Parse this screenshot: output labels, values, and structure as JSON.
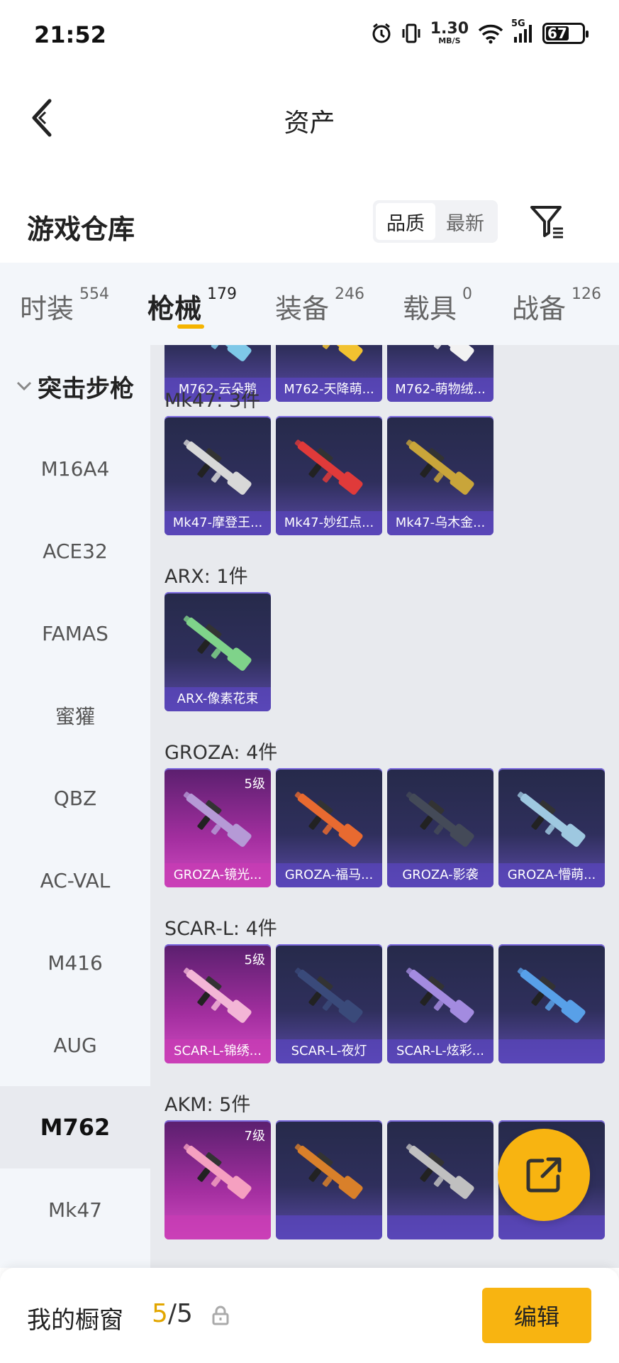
{
  "status": {
    "time": "21:52",
    "speed_value": "1.30",
    "speed_unit": "MB/S",
    "network": "5G",
    "battery": "67"
  },
  "header": {
    "title": "资产"
  },
  "warehouse": {
    "title": "游戏仓库",
    "sort_options": [
      "品质",
      "最新"
    ],
    "sort_selected": "品质"
  },
  "tabs": [
    {
      "label": "时装",
      "count": "554"
    },
    {
      "label": "枪械",
      "count": "179"
    },
    {
      "label": "装备",
      "count": "246"
    },
    {
      "label": "载具",
      "count": "0"
    },
    {
      "label": "战备",
      "count": "126"
    }
  ],
  "active_tab": "枪械",
  "sidebar": {
    "category": "突击步枪",
    "items": [
      "M16A4",
      "ACE32",
      "FAMAS",
      "蜜獾",
      "QBZ",
      "AC-VAL",
      "M416",
      "AUG",
      "M762",
      "Mk47"
    ],
    "selected": "M762"
  },
  "groups": [
    {
      "title": "",
      "items": [
        {
          "name": "M762-云朵鹅",
          "badge": ""
        },
        {
          "name": "M762-天降萌...",
          "badge": ""
        },
        {
          "name": "M762-萌物绒...",
          "badge": ""
        }
      ]
    },
    {
      "title": "Mk47: 3件",
      "items": [
        {
          "name": "Mk47-摩登王...",
          "badge": ""
        },
        {
          "name": "Mk47-妙红点...",
          "badge": ""
        },
        {
          "name": "Mk47-乌木金...",
          "badge": ""
        }
      ]
    },
    {
      "title": "ARX: 1件",
      "items": [
        {
          "name": "ARX-像素花束",
          "badge": ""
        }
      ]
    },
    {
      "title": "GROZA: 4件",
      "items": [
        {
          "name": "GROZA-镜光...",
          "badge": "5级"
        },
        {
          "name": "GROZA-福马...",
          "badge": ""
        },
        {
          "name": "GROZA-影袭",
          "badge": ""
        },
        {
          "name": "GROZA-懵萌...",
          "badge": ""
        }
      ]
    },
    {
      "title": "SCAR-L: 4件",
      "items": [
        {
          "name": "SCAR-L-锦绣...",
          "badge": "5级"
        },
        {
          "name": "SCAR-L-夜灯",
          "badge": ""
        },
        {
          "name": "SCAR-L-炫彩...",
          "badge": ""
        },
        {
          "name": "",
          "badge": ""
        }
      ]
    },
    {
      "title": "AKM: 5件",
      "items": [
        {
          "name": "",
          "badge": "7级"
        },
        {
          "name": "",
          "badge": ""
        },
        {
          "name": "",
          "badge": ""
        },
        {
          "name": "",
          "badge": ""
        }
      ]
    }
  ],
  "bottom": {
    "label": "我的橱窗",
    "current": "5",
    "total": "5",
    "edit_label": "编辑"
  },
  "colors": {
    "accent": "#f8b411",
    "tab_underline": "#f5b400",
    "card_blue": "#2f2f5c",
    "card_purple": "#a42fa0"
  },
  "icons": [
    "back-arrow-icon",
    "filter-icon",
    "share-icon",
    "lock-icon",
    "chevron-down-icon",
    "alarm-icon",
    "vibrate-icon",
    "wifi-icon",
    "signal-icon",
    "battery-icon"
  ]
}
